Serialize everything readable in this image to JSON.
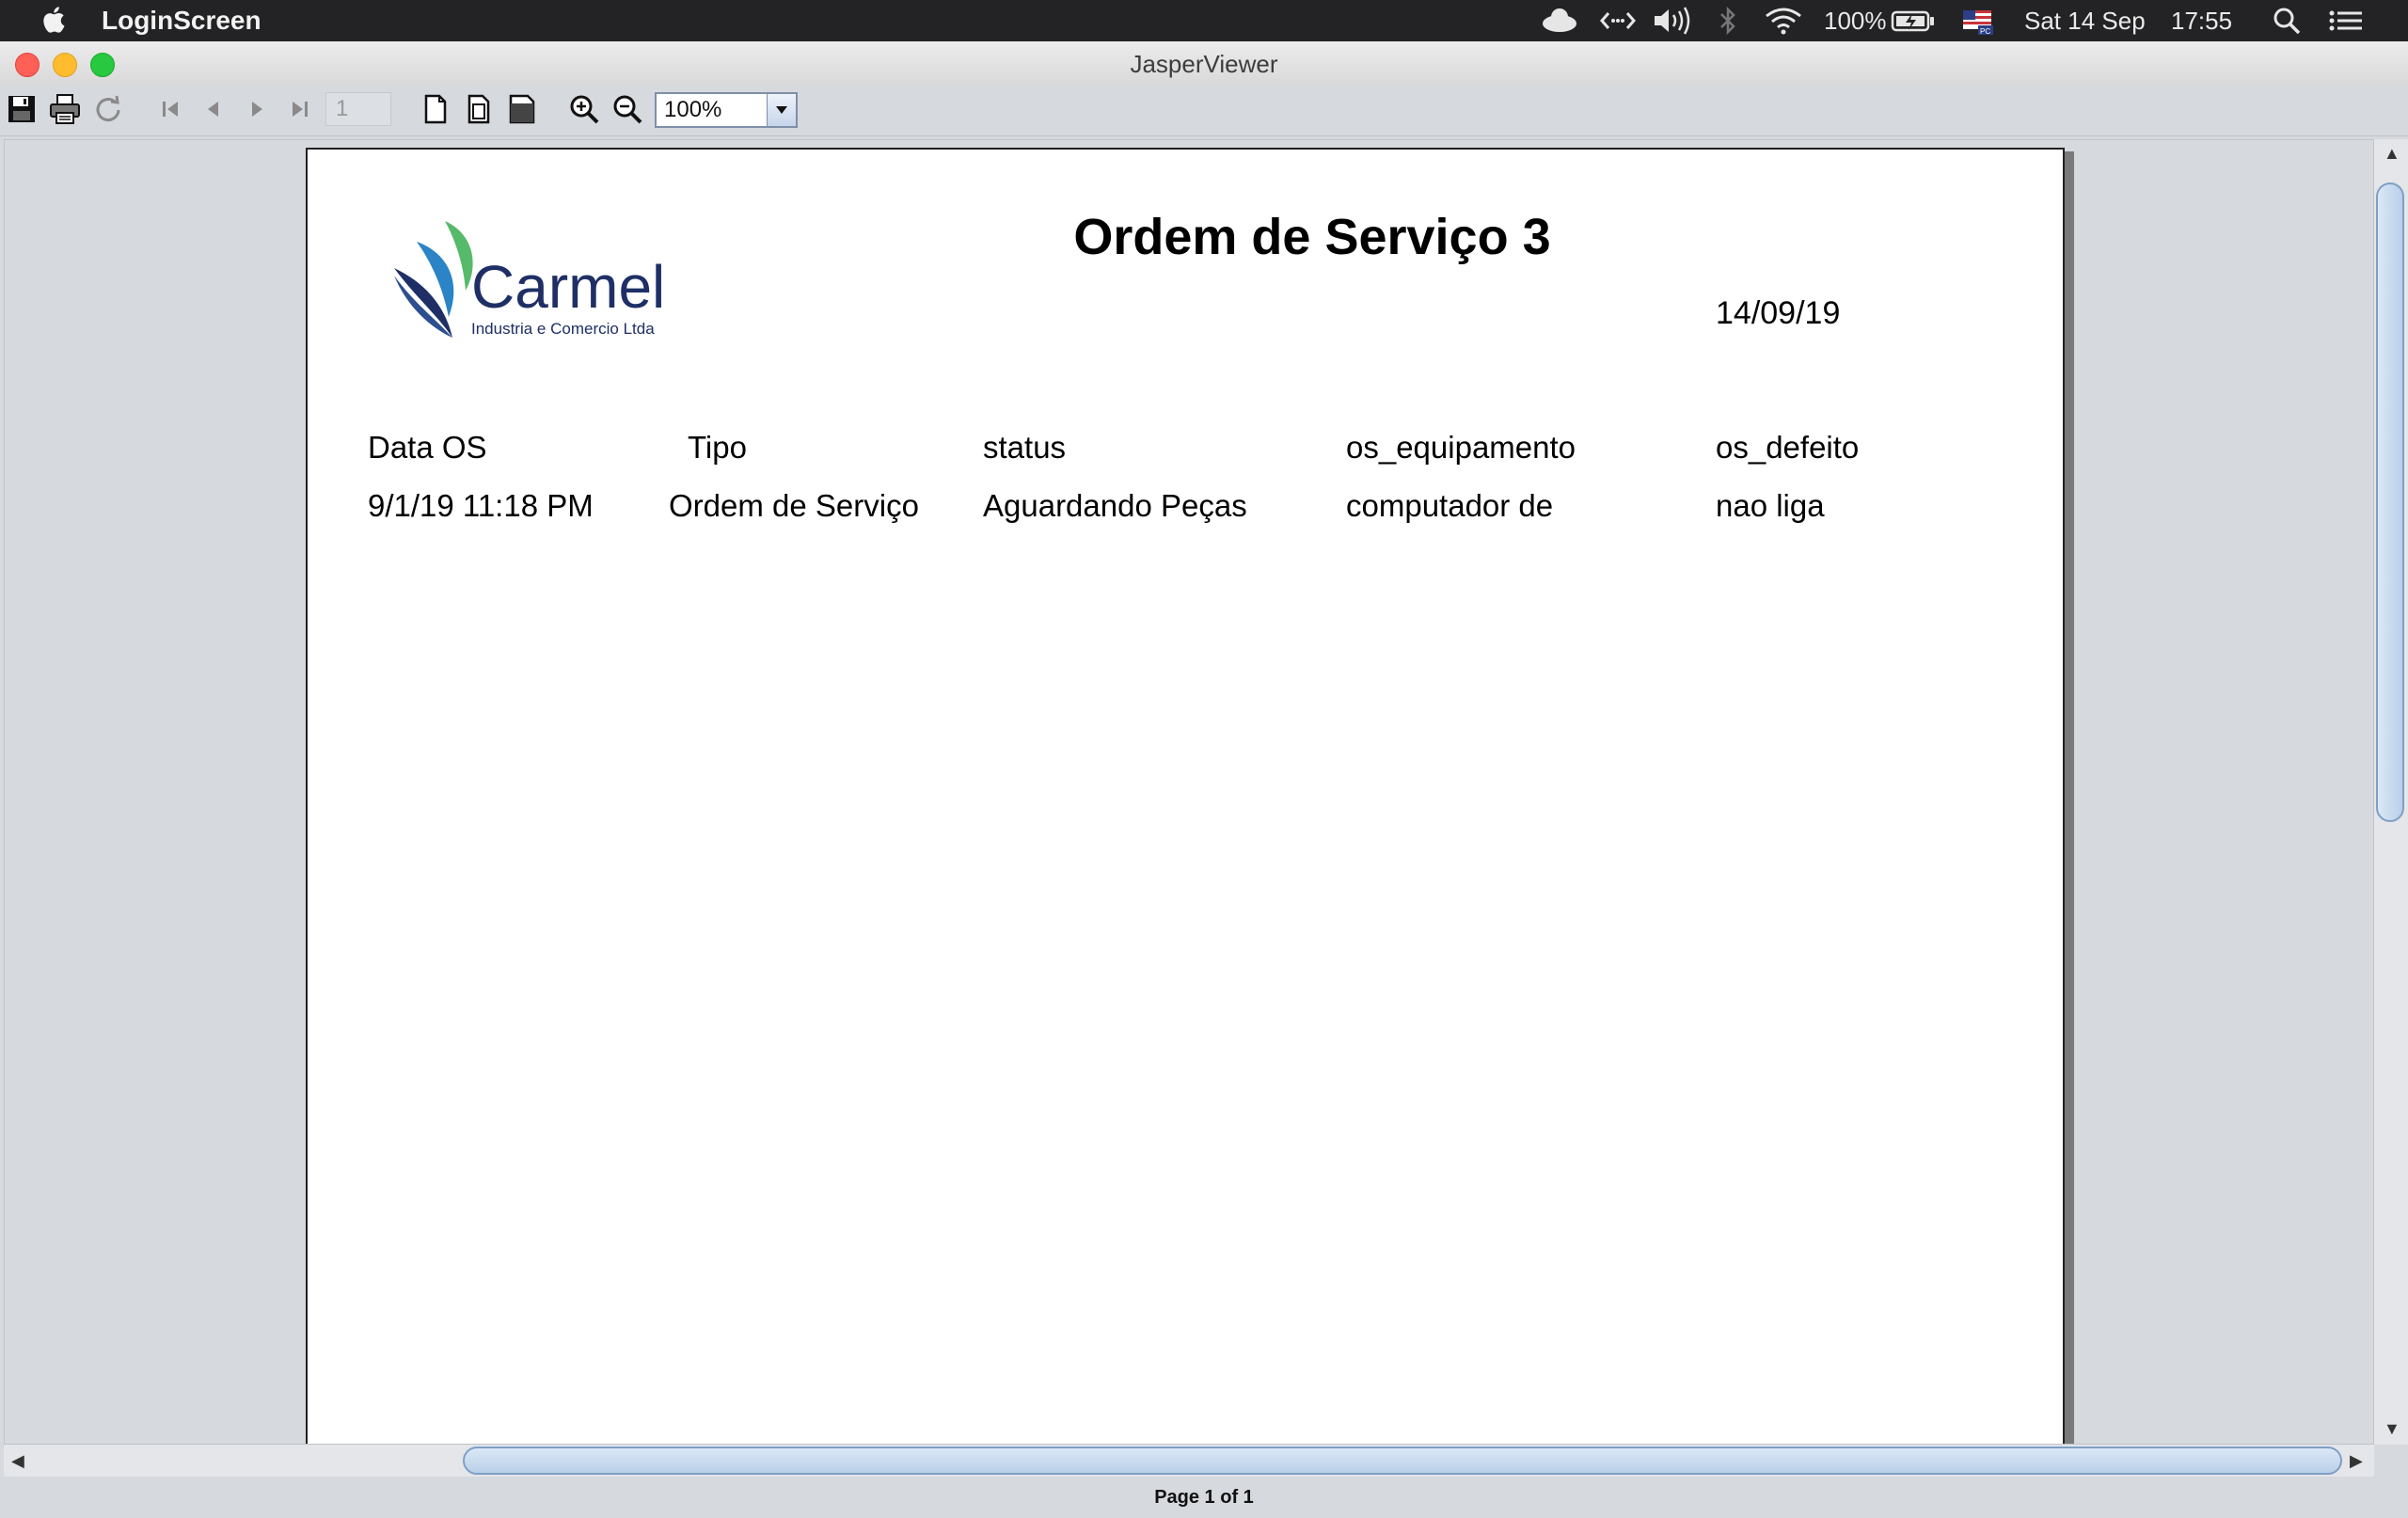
{
  "menubar": {
    "app_name": "LoginScreen",
    "battery": "100%",
    "date": "Sat 14 Sep",
    "time": "17:55"
  },
  "window": {
    "title": "JasperViewer"
  },
  "toolbar": {
    "page_number": "1",
    "zoom": "100%"
  },
  "report": {
    "logo_text": "Carmel",
    "logo_subtitle": "Industria e Comercio Ltda",
    "title": "Ordem de Serviço 3",
    "date": "14/09/19",
    "columns": [
      "Data OS",
      "Tipo",
      "status",
      "os_equipamento",
      "os_defeito"
    ],
    "rows": [
      [
        "9/1/19 11:18 PM",
        "Ordem de Serviço",
        "Aguardando Peças",
        "computador de",
        "nao liga"
      ]
    ]
  },
  "status": {
    "text": "Page 1 of 1"
  },
  "colors": {
    "logo_navy": "#1f2f66",
    "logo_blue": "#2a84c5",
    "logo_green": "#57b96a"
  }
}
